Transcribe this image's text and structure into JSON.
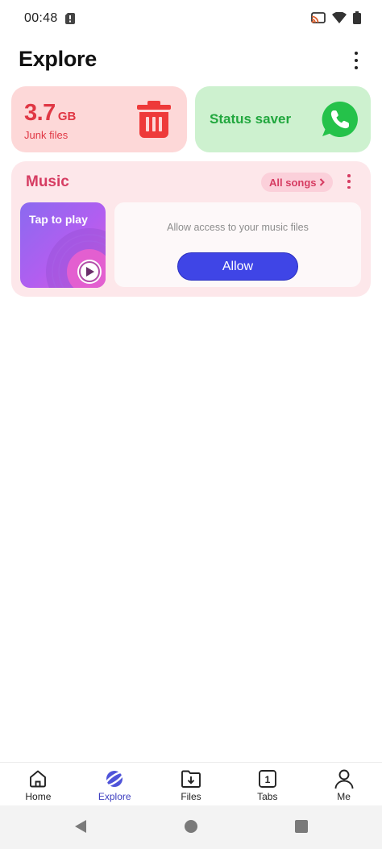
{
  "status_bar": {
    "time": "00:48"
  },
  "header": {
    "title": "Explore"
  },
  "junk_card": {
    "size_value": "3.7",
    "size_unit": "GB",
    "label": "Junk files",
    "accent_color": "#e03744"
  },
  "saver_card": {
    "label": "Status saver",
    "accent_color": "#21a73e"
  },
  "music": {
    "title": "Music",
    "all_songs_label": "All songs",
    "tap_to_play": "Tap to play",
    "access_text": "Allow access to your music files",
    "allow_label": "Allow",
    "accent_color": "#d63c62",
    "button_color": "#3f45e6"
  },
  "bottom_nav": {
    "items": [
      {
        "label": "Home",
        "icon": "home-icon"
      },
      {
        "label": "Explore",
        "icon": "planet-icon",
        "active": true
      },
      {
        "label": "Files",
        "icon": "download-folder-icon"
      },
      {
        "label": "Tabs",
        "icon": "tabs-icon",
        "badge": "1"
      },
      {
        "label": "Me",
        "icon": "person-icon"
      }
    ]
  }
}
